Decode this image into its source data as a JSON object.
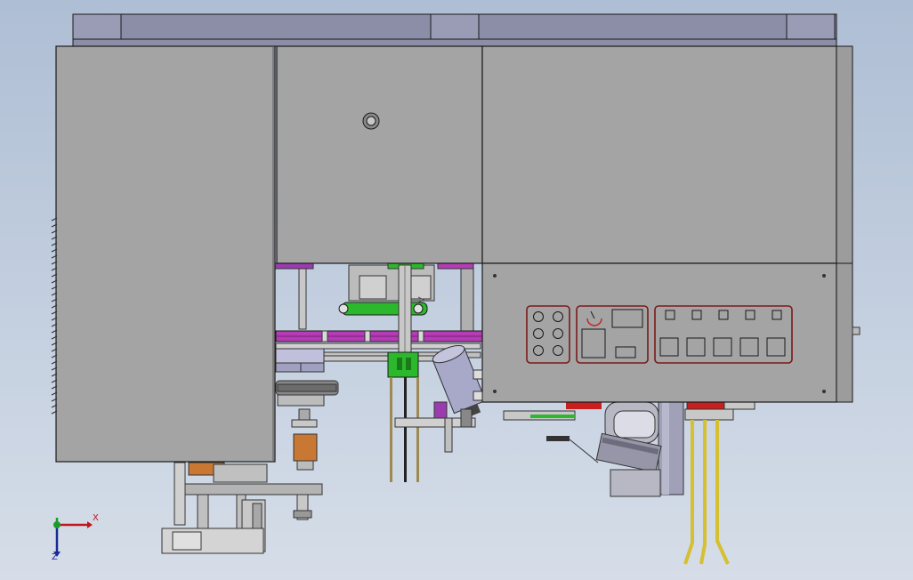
{
  "axes": {
    "x_label": "X",
    "z_label": "Z"
  },
  "colors": {
    "background_top": "#aebed4",
    "background_bottom": "#d6dde8",
    "panel": "#a4a4a4",
    "top_plate": "#8c8ea8",
    "cutter_purple": "#b43cb4",
    "clamp_green": "#2cb82c",
    "bearing_orange": "#c87832",
    "control_outline": "#7a1a1a",
    "accent_red": "#c81e1e",
    "lead_wire_yellow": "#d4c030",
    "axis_x": "#c0161b",
    "axis_y": "#1a9c2a",
    "axis_z": "#1a2a9c"
  },
  "control_panel": {
    "left_group": {
      "buttons": 6
    },
    "middle_group": {
      "displays": 3,
      "icon": "gauge-arc-icon"
    },
    "right_group": {
      "buttons": 10
    }
  }
}
